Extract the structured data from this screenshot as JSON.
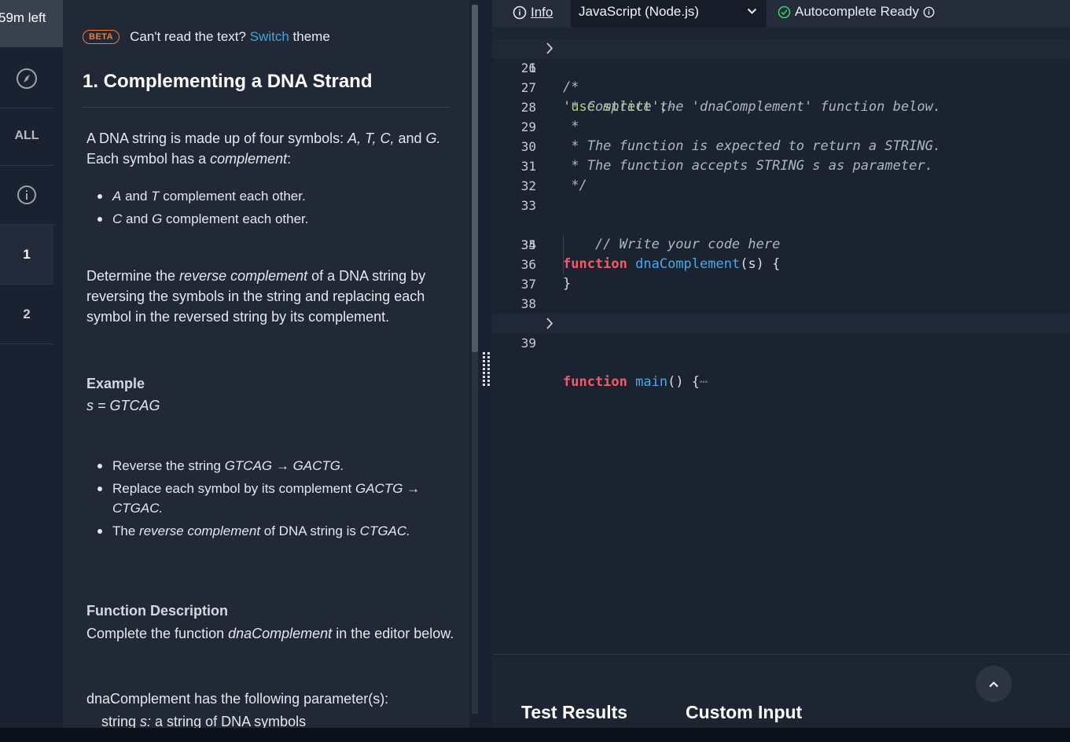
{
  "timer": {
    "label": "59m left"
  },
  "rail": {
    "all_label": "ALL",
    "questions": [
      "1",
      "2"
    ]
  },
  "problem": {
    "beta_label": "BETA",
    "theme_prefix": "Can't read the text?",
    "theme_link": "Switch",
    "theme_suffix": "theme",
    "title": "1. Complementing a DNA Strand",
    "intro": {
      "t1": "A DNA string is made up of four symbols: ",
      "a": "A, T, C,",
      "t2": " and ",
      "g": "G.",
      "t3": " Each symbol has a ",
      "complement": "complement",
      "t4": ":"
    },
    "pairs": [
      {
        "x": "A",
        "mid": " and ",
        "y": "T",
        "rest": " complement each other."
      },
      {
        "x": "C",
        "mid": " and ",
        "y": "G",
        "rest": " complement each other."
      }
    ],
    "determine": {
      "t1": "Determine the ",
      "em": "reverse complement",
      "t2": " of a DNA string by reversing the symbols in the string and replacing each symbol in the reversed string by its complement."
    },
    "example_heading": "Example",
    "example_value": "s = GTCAG",
    "steps": [
      {
        "t1": "Reverse the string ",
        "em1": "GTCAG → GACTG."
      },
      {
        "t1": "Replace each symbol by its complement ",
        "em1": "GACTG → CTGAC."
      },
      {
        "t1": "The ",
        "em1": "reverse complement",
        "t2": " of DNA string is ",
        "em2": "CTGAC."
      }
    ],
    "func_heading": "Function Description",
    "func_desc": {
      "t1": "Complete the function ",
      "em": "dnaComplement",
      "t2": " in the editor below."
    },
    "params_intro": "dnaComplement has the following parameter(s):",
    "param": {
      "type": "string ",
      "name": "s:",
      "desc": " a string of DNA symbols"
    }
  },
  "editor": {
    "info_label": "Info",
    "language": "JavaScript (Node.js)",
    "autocomplete": "Autocomplete Ready",
    "lines": [
      {
        "n": "1",
        "fold": true
      },
      {
        "n": "26"
      },
      {
        "n": "27"
      },
      {
        "n": "28"
      },
      {
        "n": "29"
      },
      {
        "n": "30"
      },
      {
        "n": "31"
      },
      {
        "n": "32"
      },
      {
        "n": "33"
      },
      {
        "n": "34"
      },
      {
        "n": "35"
      },
      {
        "n": "36"
      },
      {
        "n": "37"
      },
      {
        "n": "38"
      },
      {
        "n": "39",
        "fold": true
      }
    ],
    "code": {
      "l1": "'use strict';",
      "l27": "/*",
      "l28": " * Complete the 'dnaComplement' function below.",
      "l29": " *",
      "l30": " * The function is expected to return a STRING.",
      "l31": " * The function accepts STRING s as parameter.",
      "l32": " */",
      "l34_kw": "function",
      "l34_fn": "dnaComplement",
      "l34_rest": "(s) {",
      "l35": "    // Write your code here",
      "l37": "}",
      "l39_kw": "function",
      "l39_fn": "main",
      "l39_rest": "() {",
      "ellipsis": "⋯"
    },
    "tabs": [
      "Test Results",
      "Custom Input"
    ]
  },
  "colors": {
    "accent_orange": "#f37b34",
    "link_blue": "#3aa8e8",
    "keyword_red": "#f25a6a",
    "function_blue": "#48a9e6",
    "string_green": "#a6d47c",
    "ok_green": "#3ecf6a"
  }
}
